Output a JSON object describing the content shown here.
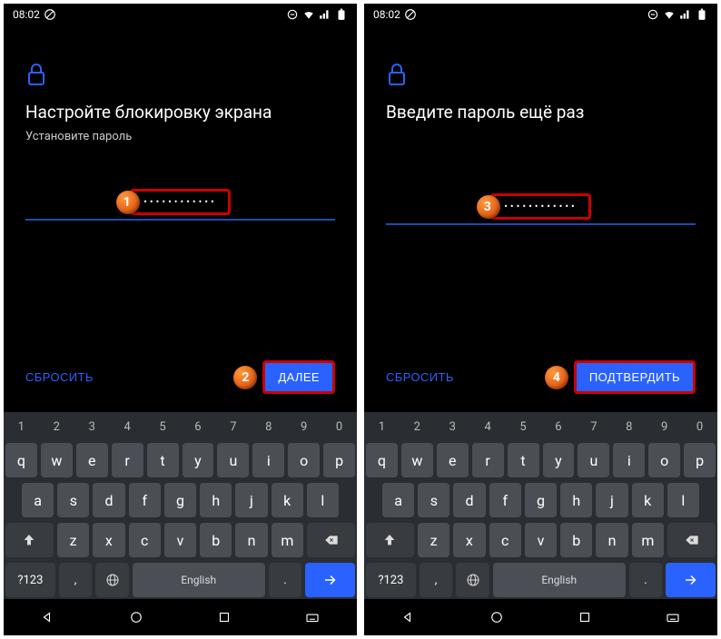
{
  "statusbar": {
    "time": "08:02"
  },
  "screens": {
    "left": {
      "title": "Настройте блокировку экрана",
      "subtitle": "Установите пароль",
      "password_mask": "••••••••••••",
      "reset_label": "СБРОСИТЬ",
      "next_label": "ДАЛЕЕ",
      "badge_input": "1",
      "badge_next": "2"
    },
    "right": {
      "title": "Введите пароль ещё раз",
      "subtitle": "",
      "password_mask": "••••••••••••",
      "reset_label": "СБРОСИТЬ",
      "next_label": "ПОДТВЕРДИТЬ",
      "badge_input": "3",
      "badge_next": "4"
    }
  },
  "keyboard": {
    "numbers": [
      "1",
      "2",
      "3",
      "4",
      "5",
      "6",
      "7",
      "8",
      "9",
      "0"
    ],
    "row1": [
      "q",
      "w",
      "e",
      "r",
      "t",
      "y",
      "u",
      "i",
      "o",
      "p"
    ],
    "row2": [
      "a",
      "s",
      "d",
      "f",
      "g",
      "h",
      "j",
      "k",
      "l"
    ],
    "row3": [
      "z",
      "x",
      "c",
      "v",
      "b",
      "n",
      "m"
    ],
    "symbols_label": "?123",
    "space_label": "English",
    "comma": ",",
    "period": "."
  }
}
